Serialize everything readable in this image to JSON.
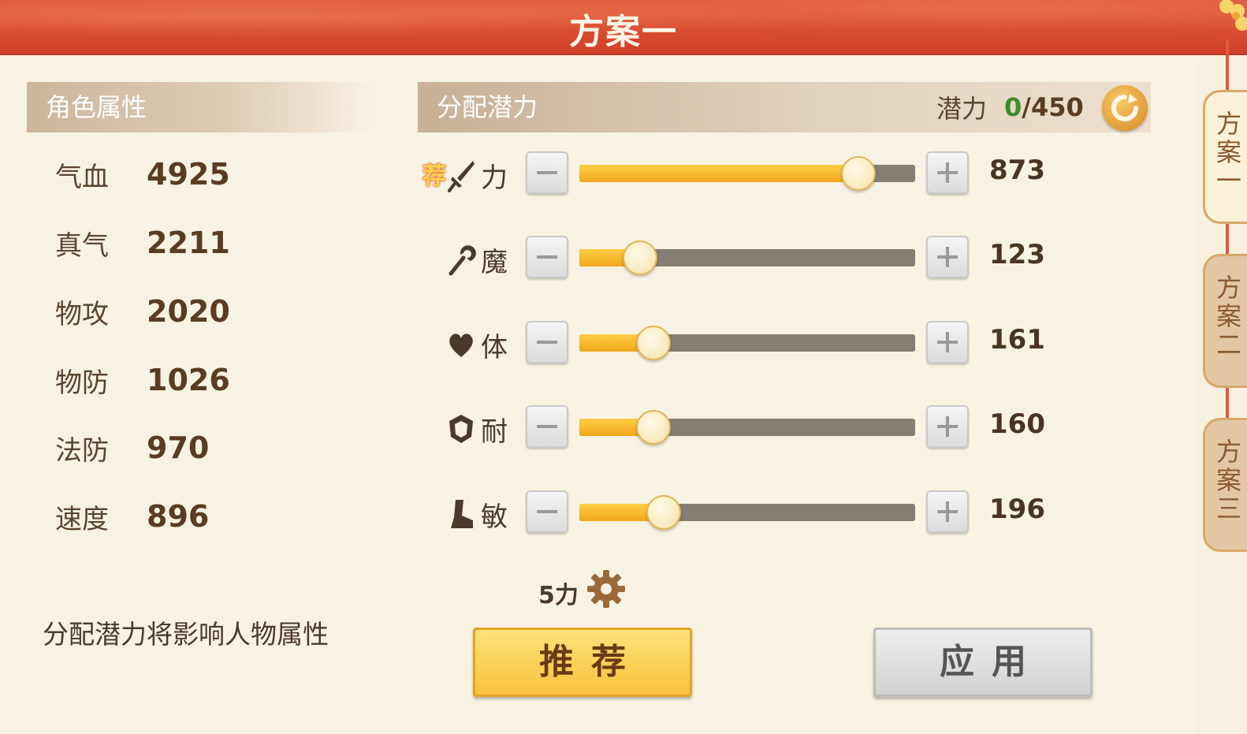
{
  "title": "方案一",
  "attributes": {
    "header": "角色属性",
    "items": [
      {
        "label": "气血",
        "value": "4925"
      },
      {
        "label": "真气",
        "value": "2211"
      },
      {
        "label": "物攻",
        "value": "2020"
      },
      {
        "label": "物防",
        "value": "1026"
      },
      {
        "label": "法防",
        "value": "970"
      },
      {
        "label": "速度",
        "value": "896"
      }
    ],
    "hint": "分配潜力将影响人物属性"
  },
  "allocation": {
    "header": "分配潜力",
    "potential_label": "潜力",
    "potential_used": "0",
    "potential_total": "/450",
    "recommended_tag": "荐",
    "stats": [
      {
        "name": "力",
        "icon": "sword-icon",
        "value": "873",
        "level": 0.83
      },
      {
        "name": "魔",
        "icon": "staff-icon",
        "value": "123",
        "level": 0.18
      },
      {
        "name": "体",
        "icon": "heart-icon",
        "value": "161",
        "level": 0.22
      },
      {
        "name": "耐",
        "icon": "shield-icon",
        "value": "160",
        "level": 0.22
      },
      {
        "name": "敏",
        "icon": "boot-icon",
        "value": "196",
        "level": 0.25
      }
    ],
    "preset_label": "5力"
  },
  "buttons": {
    "recommend": "推荐",
    "apply": "应用"
  },
  "side_tabs": [
    {
      "label": "方案一",
      "active": true
    },
    {
      "label": "方案二",
      "active": false
    },
    {
      "label": "方案三",
      "active": false
    }
  ],
  "colors": {
    "title_bar": "#d2402a",
    "slider_fill": "#f0a81c",
    "slider_track": "#857e72",
    "potential_used": "#3c8c2e",
    "recommend_button": "#f6c23a"
  }
}
